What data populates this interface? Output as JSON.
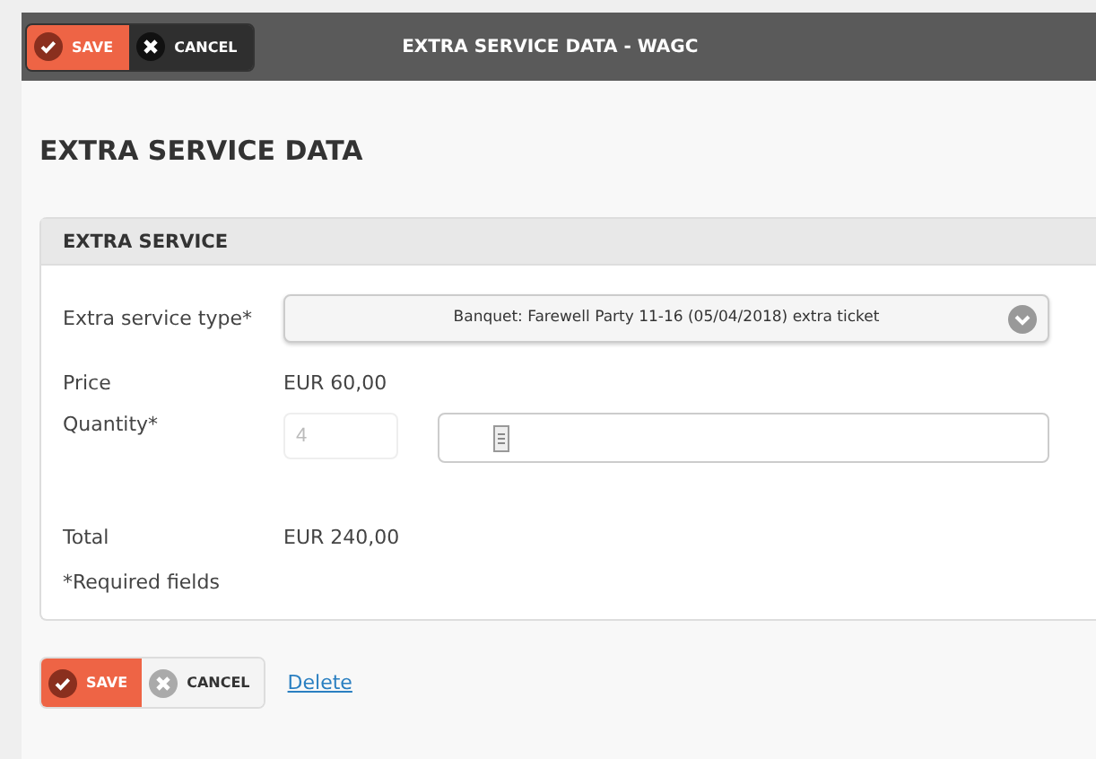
{
  "toolbar": {
    "buttons": [
      {
        "kind": "save",
        "label": "SAVE"
      },
      {
        "kind": "cancel",
        "label": "CANCEL"
      }
    ],
    "title": "EXTRA SERVICE DATA - WAGC"
  },
  "heading": "EXTRA SERVICE DATA",
  "panel": {
    "title": "EXTRA SERVICE",
    "rows": [
      {
        "kind": "select",
        "label": "Extra service type*",
        "value": "Banquet: Farewell Party 11-16 (05/04/2018) extra ticket"
      },
      {
        "kind": "text",
        "label": "Price",
        "value": "EUR 60,00"
      },
      {
        "kind": "quantity",
        "label": "Quantity*",
        "placeholder": "4"
      },
      {
        "kind": "text",
        "label": "Total",
        "value": "EUR 240,00"
      }
    ],
    "note": "*Required fields"
  },
  "footer": {
    "buttons": [
      {
        "kind": "save",
        "label": "SAVE"
      },
      {
        "kind": "cancel",
        "label": "CANCEL"
      }
    ],
    "link": "Delete"
  }
}
